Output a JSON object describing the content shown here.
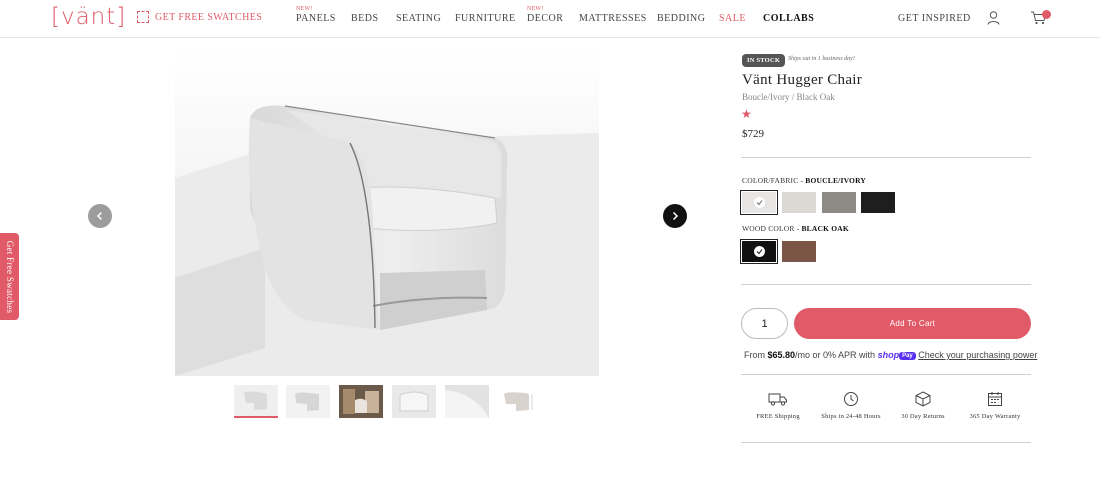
{
  "header": {
    "logo": "[vänt]",
    "swatch_link": "GET FREE SWATCHES",
    "nav": [
      {
        "label": "PANELS",
        "badge": "NEW!"
      },
      {
        "label": "BEDS",
        "badge": ""
      },
      {
        "label": "SEATING",
        "badge": ""
      },
      {
        "label": "FURNITURE",
        "badge": ""
      },
      {
        "label": "DECOR",
        "badge": "NEW!"
      },
      {
        "label": "MATTRESSES",
        "badge": ""
      },
      {
        "label": "BEDDING",
        "badge": ""
      },
      {
        "label": "SALE",
        "badge": ""
      },
      {
        "label": "COLLABS",
        "badge": ""
      }
    ],
    "inspired": "GET INSPIRED",
    "icons": {
      "user": "user-icon",
      "cart": "cart-icon"
    }
  },
  "side_tab": "Get Free Swatches",
  "gallery": {
    "thumbnail_count": 6
  },
  "product": {
    "stock_badge": "IN STOCK",
    "ships_note": "Ships out in 1 business day!",
    "title": "Vänt Hugger Chair",
    "variant": "Boucle/Ivory / Black Oak",
    "rating_star": "★",
    "price": "$729"
  },
  "options": {
    "fabric": {
      "label": "COLOR/FABRIC - ",
      "selected": "BOUCLE/IVORY",
      "swatches": [
        {
          "name": "boucle-ivory",
          "color": "#e8e6e4",
          "selected": true
        },
        {
          "name": "light-grey",
          "color": "#dcd9d5",
          "selected": false
        },
        {
          "name": "taupe",
          "color": "#8d8985",
          "selected": false
        },
        {
          "name": "black",
          "color": "#1e1e1e",
          "selected": false
        }
      ]
    },
    "wood": {
      "label": "WOOD COLOR - ",
      "selected": "BLACK OAK",
      "swatches": [
        {
          "name": "black-oak",
          "color": "#111111",
          "selected": true
        },
        {
          "name": "walnut",
          "color": "#7b5646",
          "selected": false
        }
      ]
    }
  },
  "cart": {
    "quantity": "1",
    "add_label": "Add To Cart"
  },
  "shoppay": {
    "prefix": "From ",
    "amount": "$65.80",
    "middle": "/mo or 0% APR with ",
    "logo": "shop",
    "logo_pay": "Pay",
    "link": "Check your purchasing power"
  },
  "features": [
    {
      "label": "FREE Shipping",
      "icon": "truck-icon"
    },
    {
      "label": "Ships in 24-48 Hours",
      "icon": "clock-icon"
    },
    {
      "label": "30 Day Returns",
      "icon": "box-icon"
    },
    {
      "label": "365 Day Warranty",
      "icon": "calendar-icon"
    }
  ],
  "colors": {
    "brand": "#e05a67",
    "text": "#333333",
    "shoppay": "#5a31f4"
  }
}
